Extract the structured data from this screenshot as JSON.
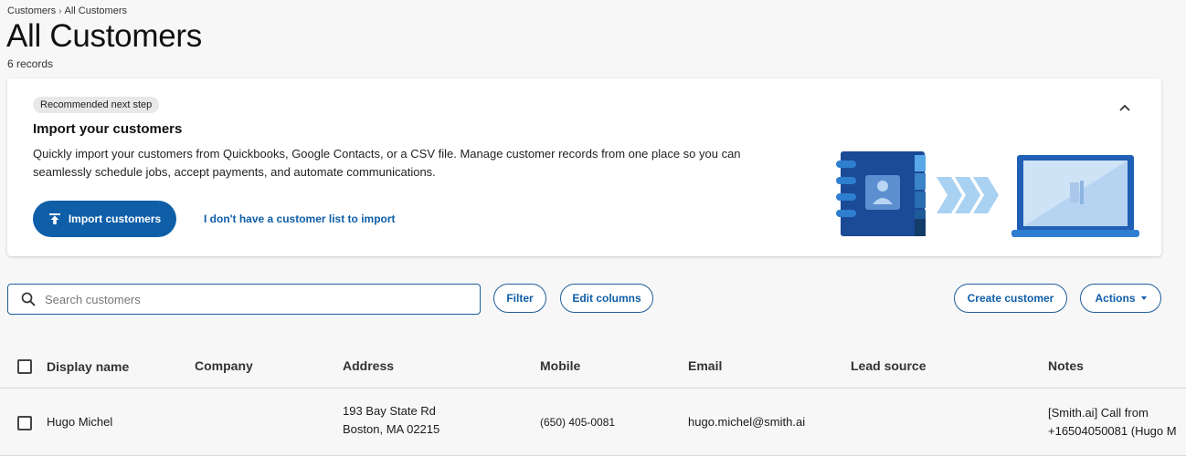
{
  "breadcrumb": {
    "root": "Customers",
    "separator": "›",
    "current": "All Customers"
  },
  "page": {
    "title": "All Customers",
    "record_count": "6 records"
  },
  "banner": {
    "chip": "Recommended next step",
    "title": "Import your customers",
    "description": "Quickly import your customers from Quickbooks, Google Contacts, or a CSV file. Manage customer records from one place so you can seamlessly schedule jobs, accept payments, and automate communications.",
    "import_button": "Import customers",
    "no_list_link": "I don't have a customer list to import"
  },
  "toolbar": {
    "search_placeholder": "Search customers",
    "filter": "Filter",
    "edit_columns": "Edit columns",
    "create_customer": "Create customer",
    "actions": "Actions"
  },
  "table": {
    "columns": [
      "Display name",
      "Company",
      "Address",
      "Mobile",
      "Email",
      "Lead source",
      "Notes"
    ],
    "rows": [
      {
        "display_name": "Hugo Michel",
        "company": "",
        "address_line1": "193 Bay State Rd",
        "address_line2": "Boston, MA 02215",
        "mobile": "(650) 405-0081",
        "email": "hugo.michel@smith.ai",
        "lead_source": "",
        "notes_line1": "[Smith.ai] Call from",
        "notes_line2": "+16504050081 (Hugo M"
      }
    ]
  },
  "colors": {
    "primary": "#0e5ea8",
    "background": "#f7f7f8",
    "border": "#1f5d99"
  },
  "icons": [
    "chevron-up-icon",
    "upload-icon",
    "search-icon",
    "caret-down-icon"
  ]
}
